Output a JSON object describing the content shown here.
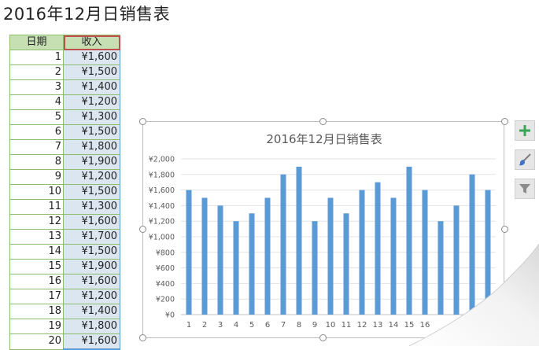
{
  "title": "2016年12月日销售表",
  "table": {
    "header_date": "日期",
    "header_income": "收入",
    "rows": [
      {
        "day": "1",
        "income": "¥1,600"
      },
      {
        "day": "2",
        "income": "¥1,500"
      },
      {
        "day": "3",
        "income": "¥1,400"
      },
      {
        "day": "4",
        "income": "¥1,200"
      },
      {
        "day": "5",
        "income": "¥1,300"
      },
      {
        "day": "6",
        "income": "¥1,500"
      },
      {
        "day": "7",
        "income": "¥1,800"
      },
      {
        "day": "8",
        "income": "¥1,900"
      },
      {
        "day": "9",
        "income": "¥1,200"
      },
      {
        "day": "10",
        "income": "¥1,500"
      },
      {
        "day": "11",
        "income": "¥1,300"
      },
      {
        "day": "12",
        "income": "¥1,600"
      },
      {
        "day": "13",
        "income": "¥1,700"
      },
      {
        "day": "14",
        "income": "¥1,500"
      },
      {
        "day": "15",
        "income": "¥1,900"
      },
      {
        "day": "16",
        "income": "¥1,600"
      },
      {
        "day": "17",
        "income": "¥1,200"
      },
      {
        "day": "18",
        "income": "¥1,400"
      },
      {
        "day": "19",
        "income": "¥1,800"
      },
      {
        "day": "20",
        "income": "¥1,600"
      }
    ]
  },
  "chart_data": {
    "type": "bar",
    "title": "2016年12月日销售表",
    "categories": [
      "1",
      "2",
      "3",
      "4",
      "5",
      "6",
      "7",
      "8",
      "9",
      "10",
      "11",
      "12",
      "13",
      "14",
      "15",
      "16",
      "17",
      "18",
      "19",
      "20"
    ],
    "values": [
      1600,
      1500,
      1400,
      1200,
      1300,
      1500,
      1800,
      1900,
      1200,
      1500,
      1300,
      1600,
      1700,
      1500,
      1900,
      1600,
      1200,
      1400,
      1800,
      1600
    ],
    "visible_category_labels": [
      "1",
      "2",
      "3",
      "4",
      "5",
      "6",
      "7",
      "8",
      "9",
      "10",
      "11",
      "12",
      "13",
      "14",
      "15",
      "16"
    ],
    "ylim": [
      0,
      2000
    ],
    "yticks": [
      "¥0",
      "¥200",
      "¥400",
      "¥600",
      "¥800",
      "¥1,000",
      "¥1,200",
      "¥1,400",
      "¥1,600",
      "¥1,800",
      "¥2,000"
    ],
    "grid": true,
    "bar_color": "#5b9bd5",
    "legend": "none"
  },
  "side_buttons": [
    {
      "name": "chart-elements-button",
      "icon": "plus-icon",
      "color": "#3aa757"
    },
    {
      "name": "chart-styles-button",
      "icon": "paintbrush-icon",
      "color": "#4472c4"
    },
    {
      "name": "chart-filters-button",
      "icon": "funnel-icon",
      "color": "#7f7f7f"
    }
  ]
}
